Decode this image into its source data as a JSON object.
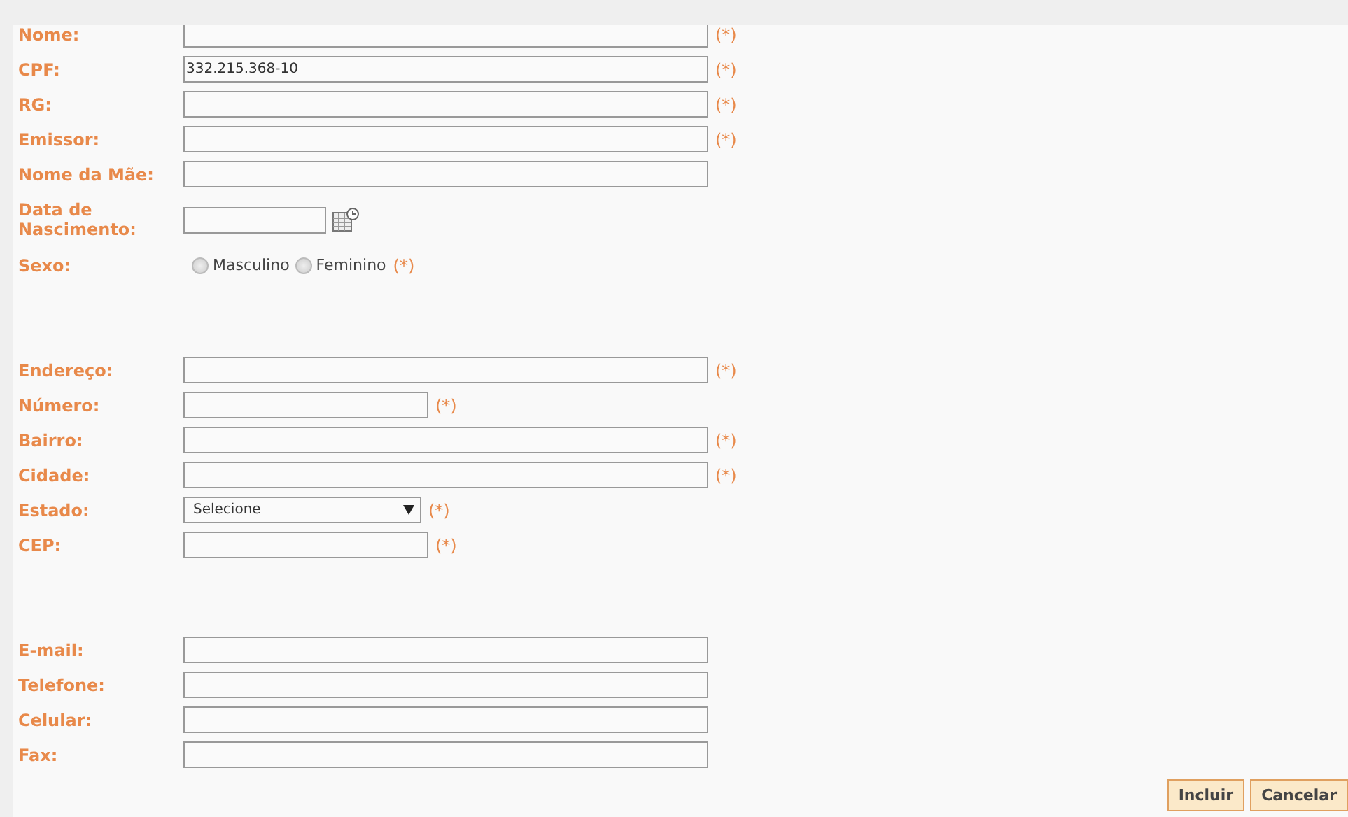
{
  "sections": [
    {
      "rows": [
        {
          "label": "Nome:",
          "kind": "text",
          "value": "",
          "required_mark": "(*)"
        },
        {
          "label": "CPF:",
          "kind": "text",
          "value": "332.215.368-10",
          "required_mark": "(*)"
        },
        {
          "label": "RG:",
          "kind": "text",
          "value": "",
          "required_mark": "(*)"
        },
        {
          "label": "Emissor:",
          "kind": "text",
          "value": "",
          "required_mark": "(*)"
        },
        {
          "label": "Nome da Mãe:",
          "kind": "text",
          "value": ""
        },
        {
          "label": "Data de Nascimento:",
          "kind": "date",
          "value": ""
        },
        {
          "label": "Sexo:",
          "kind": "radio",
          "options": [
            {
              "label": "Masculino",
              "selected": false
            },
            {
              "label": "Feminino",
              "selected": false
            }
          ],
          "required_mark": "(*)"
        }
      ]
    },
    {
      "rows": [
        {
          "label": "Endereço:",
          "kind": "text",
          "value": "",
          "required_mark": "(*)"
        },
        {
          "label": "Número:",
          "kind": "short",
          "value": "",
          "required_mark": "(*)"
        },
        {
          "label": "Bairro:",
          "kind": "text",
          "value": "",
          "required_mark": "(*)"
        },
        {
          "label": "Cidade:",
          "kind": "text",
          "value": "",
          "required_mark": "(*)"
        },
        {
          "label": "Estado:",
          "kind": "select",
          "value": "Selecione",
          "required_mark": "(*)"
        },
        {
          "label": "CEP:",
          "kind": "short",
          "value": "",
          "required_mark": "(*)"
        }
      ]
    },
    {
      "rows": [
        {
          "label": "E-mail:",
          "kind": "text",
          "value": ""
        },
        {
          "label": "Telefone:",
          "kind": "text",
          "value": ""
        },
        {
          "label": "Celular:",
          "kind": "text",
          "value": ""
        },
        {
          "label": "Fax:",
          "kind": "text",
          "value": ""
        }
      ]
    }
  ],
  "buttons": [
    "Incluir",
    "Cancelar"
  ]
}
